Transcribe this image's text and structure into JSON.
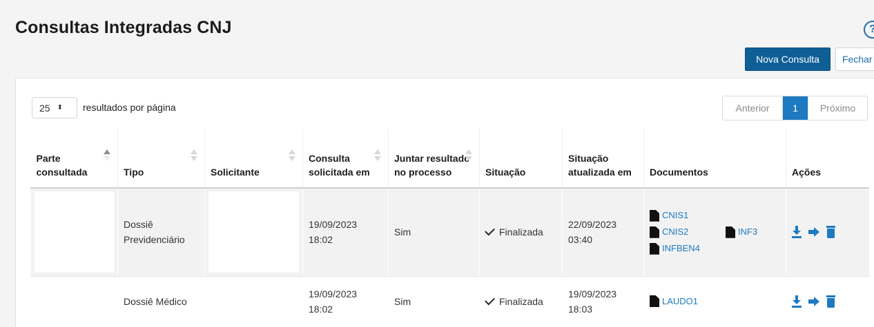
{
  "page": {
    "title": "Consultas Integradas CNJ",
    "help_icon": "?"
  },
  "toolbar": {
    "new_label": "Nova Consulta",
    "close_label": "Fechar"
  },
  "pagination": {
    "page_size": "25",
    "page_size_label": "resultados por página",
    "prev_label": "Anterior",
    "current_page": "1",
    "next_label": "Próximo"
  },
  "table": {
    "headers": [
      "Parte consultada",
      "Tipo",
      "Solicitante",
      "Consulta solicitada em",
      "Juntar resultado no processo",
      "Situação",
      "Situação atualizada em",
      "Documentos",
      "Ações"
    ],
    "rows": [
      {
        "parte": "",
        "tipo": "Dossiê Previdenciário",
        "solicitante": "",
        "solicitada_em": "19/09/2023 18:02",
        "juntar": "Sim",
        "situacao": "Finalizada",
        "atualizada_em": "22/09/2023 03:40",
        "documentos": [
          "CNIS1",
          "CNIS2",
          "INF3",
          "INFBEN4"
        ]
      },
      {
        "parte": "",
        "tipo": "Dossiê Médico",
        "solicitante": "",
        "solicitada_em": "19/09/2023 18:02",
        "juntar": "Sim",
        "situacao": "Finalizada",
        "atualizada_em": "19/09/2023 18:03",
        "documentos": [
          "LAUDO1"
        ]
      }
    ]
  },
  "icons": {
    "document": "file-icon",
    "download": "download-icon",
    "forward": "arrow-right-icon",
    "delete": "trash-icon",
    "status": "check-icon"
  },
  "colors": {
    "primary": "#0f5f96",
    "link": "#1d7ac1"
  }
}
